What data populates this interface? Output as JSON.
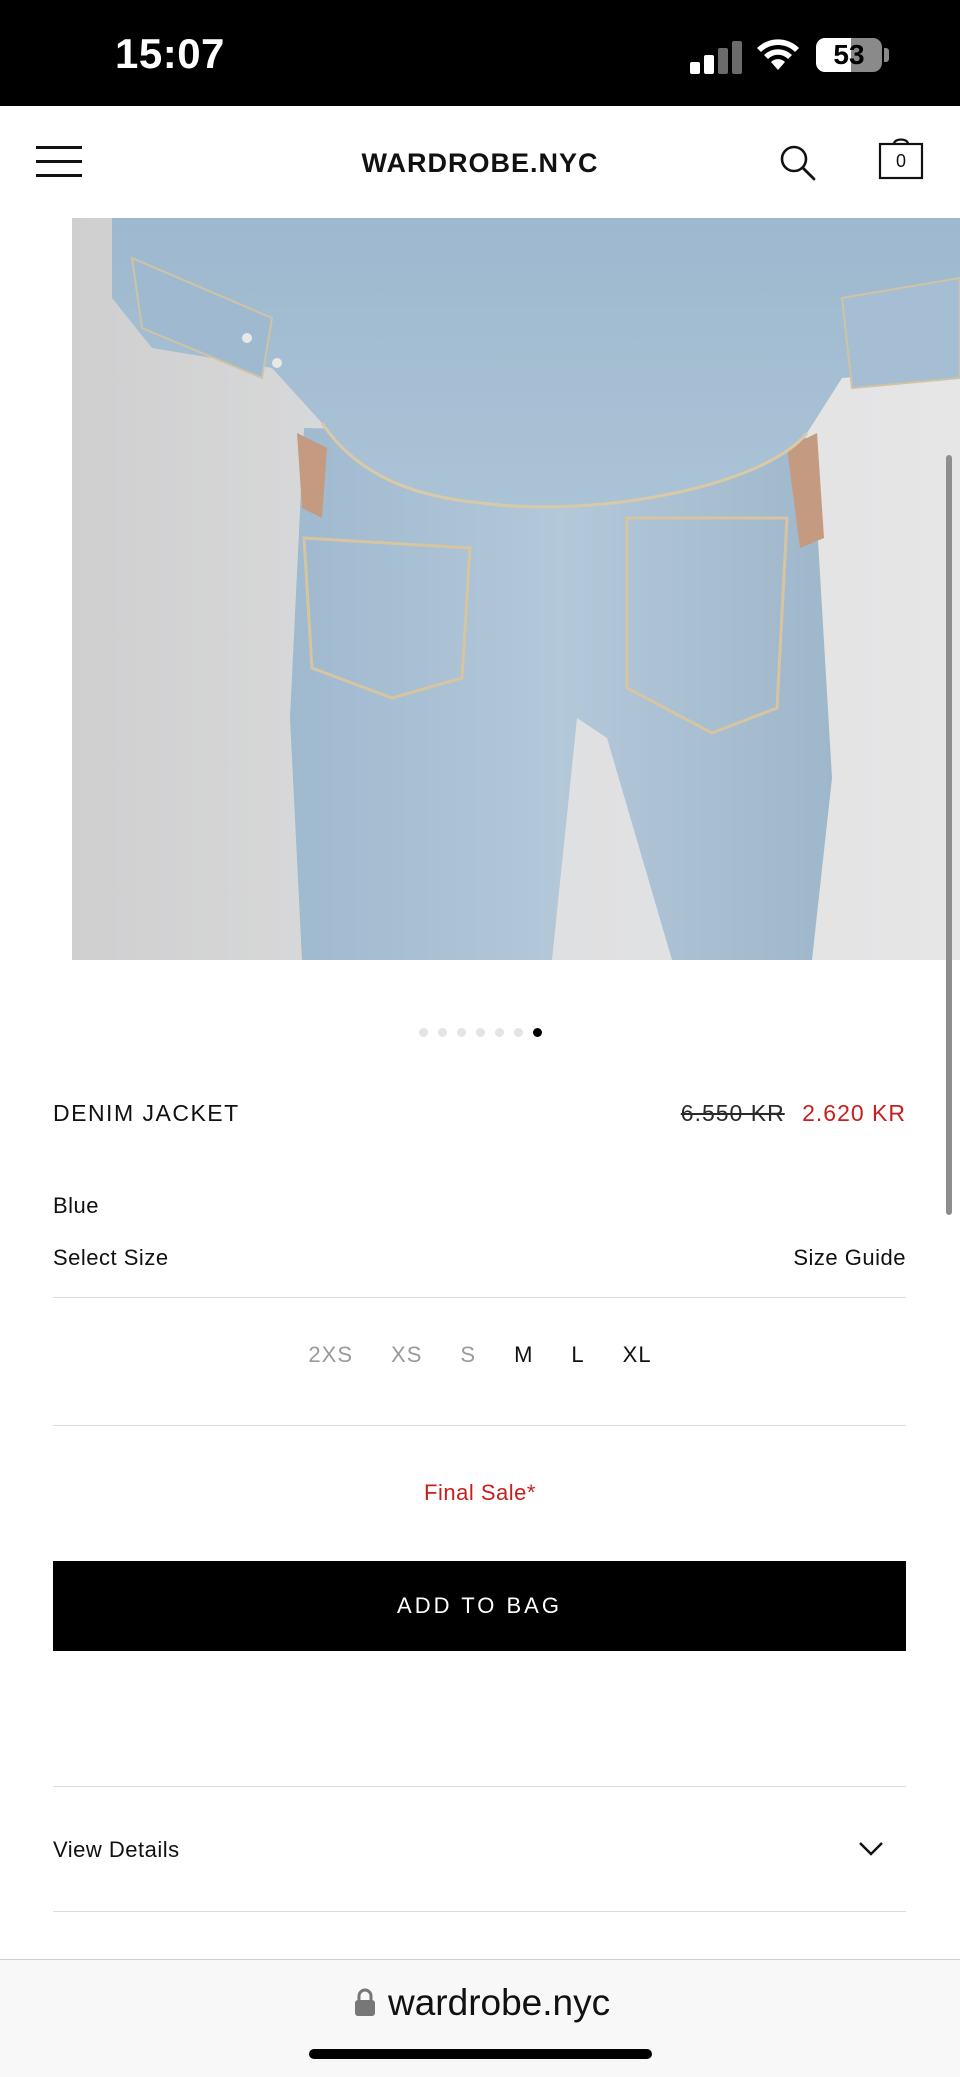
{
  "status_bar": {
    "time": "15:07",
    "battery": "53"
  },
  "header": {
    "brand": "WARDROBE.NYC",
    "bag_count": "0"
  },
  "gallery": {
    "total_images": 7,
    "active_index": 6
  },
  "product": {
    "name": "DENIM JACKET",
    "price_original": "6.550 KR",
    "price_sale": "2.620 KR",
    "color": "Blue",
    "select_size_label": "Select Size",
    "size_guide_label": "Size Guide",
    "sizes": [
      {
        "label": "2XS",
        "available": false
      },
      {
        "label": "XS",
        "available": false
      },
      {
        "label": "S",
        "available": false
      },
      {
        "label": "M",
        "available": true
      },
      {
        "label": "L",
        "available": true
      },
      {
        "label": "XL",
        "available": true
      }
    ],
    "final_sale": "Final Sale*",
    "add_to_bag": "ADD TO BAG",
    "view_details": "View Details"
  },
  "browser": {
    "url": "wardrobe.nyc"
  },
  "colors": {
    "sale_red": "#c81e1e",
    "button_black": "#000000"
  }
}
